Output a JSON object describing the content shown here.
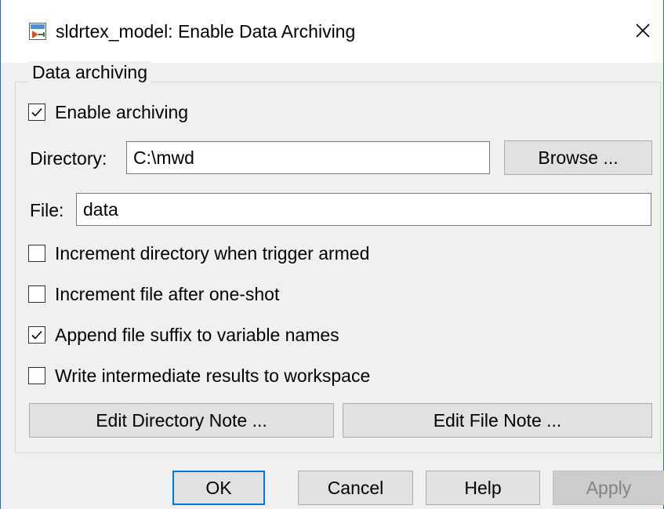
{
  "window": {
    "title": "sldrtex_model: Enable Data Archiving",
    "icon": "simulink-model-icon",
    "close_icon": "close-icon"
  },
  "group": {
    "label": "Data archiving"
  },
  "enable_archiving": {
    "label": "Enable archiving",
    "checked": true
  },
  "directory": {
    "label": "Directory:",
    "value": "C:\\mwd",
    "browse_label": "Browse ..."
  },
  "file": {
    "label": "File:",
    "value": "data"
  },
  "options": [
    {
      "label": "Increment directory when trigger armed",
      "checked": false
    },
    {
      "label": "Increment file after one-shot",
      "checked": false
    },
    {
      "label": "Append file suffix to variable names",
      "checked": true
    },
    {
      "label": "Write intermediate results to workspace",
      "checked": false
    }
  ],
  "notes": {
    "edit_directory_note": "Edit Directory Note ...",
    "edit_file_note": "Edit File Note ..."
  },
  "footer": {
    "ok": "OK",
    "cancel": "Cancel",
    "help": "Help",
    "apply": "Apply"
  },
  "colors": {
    "accent": "#0078d7",
    "window_border": "#1f6fc6",
    "dialog_bg": "#f0f0f0",
    "disabled_text": "#838383"
  }
}
